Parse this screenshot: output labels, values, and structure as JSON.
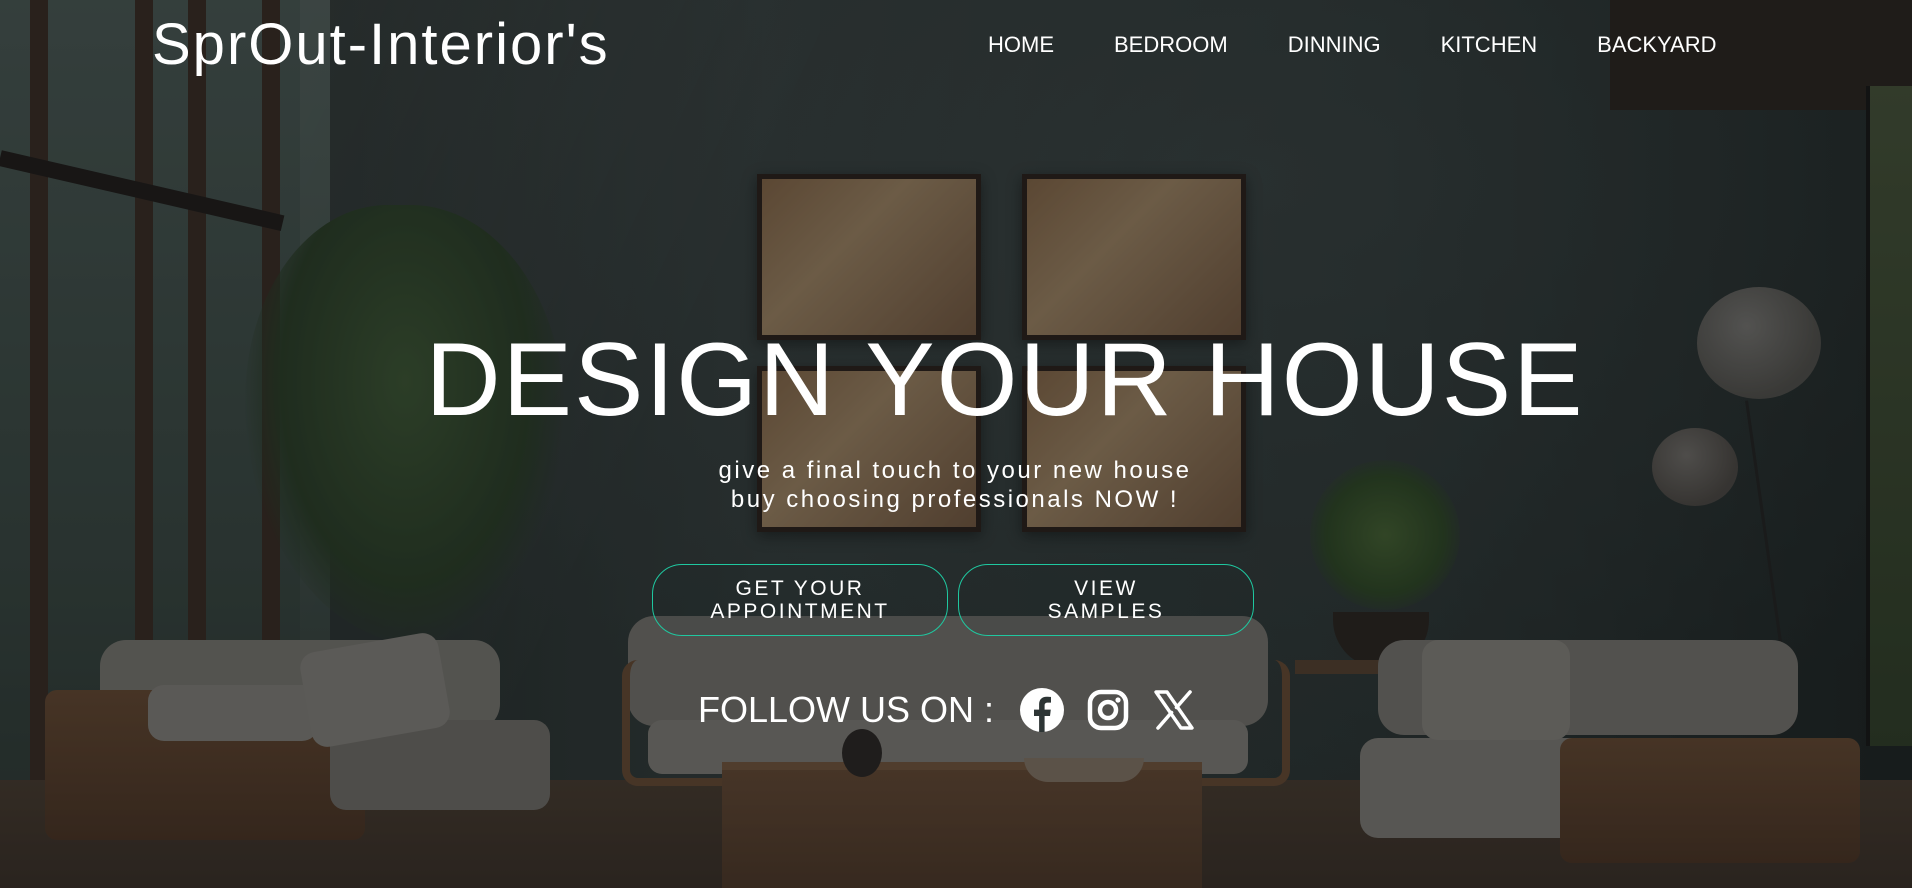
{
  "brand": {
    "logo_text": "SprOut-Interior's"
  },
  "nav": {
    "items": [
      {
        "label": "HOME"
      },
      {
        "label": "BEDROOM"
      },
      {
        "label": "DINNING"
      },
      {
        "label": "KITCHEN"
      },
      {
        "label": "BACKYARD"
      }
    ]
  },
  "hero": {
    "headline": "DESIGN YOUR HOUSE",
    "tagline_line1": "give a final touch to your new house",
    "tagline_line2": "buy choosing professionals NOW !",
    "buttons": [
      {
        "line1": "GET YOUR",
        "line2": "APPOINTMENT"
      },
      {
        "line1": "VIEW",
        "line2": "SAMPLES"
      }
    ]
  },
  "social": {
    "label": "FOLLOW US ON :",
    "icons": [
      {
        "name": "facebook-icon"
      },
      {
        "name": "instagram-icon"
      },
      {
        "name": "x-icon"
      }
    ]
  },
  "colors": {
    "text": "#ffffff",
    "button_border": "#1fc8a0",
    "overlay": "rgba(12,16,16,0.38)",
    "background": "#1f2526"
  }
}
